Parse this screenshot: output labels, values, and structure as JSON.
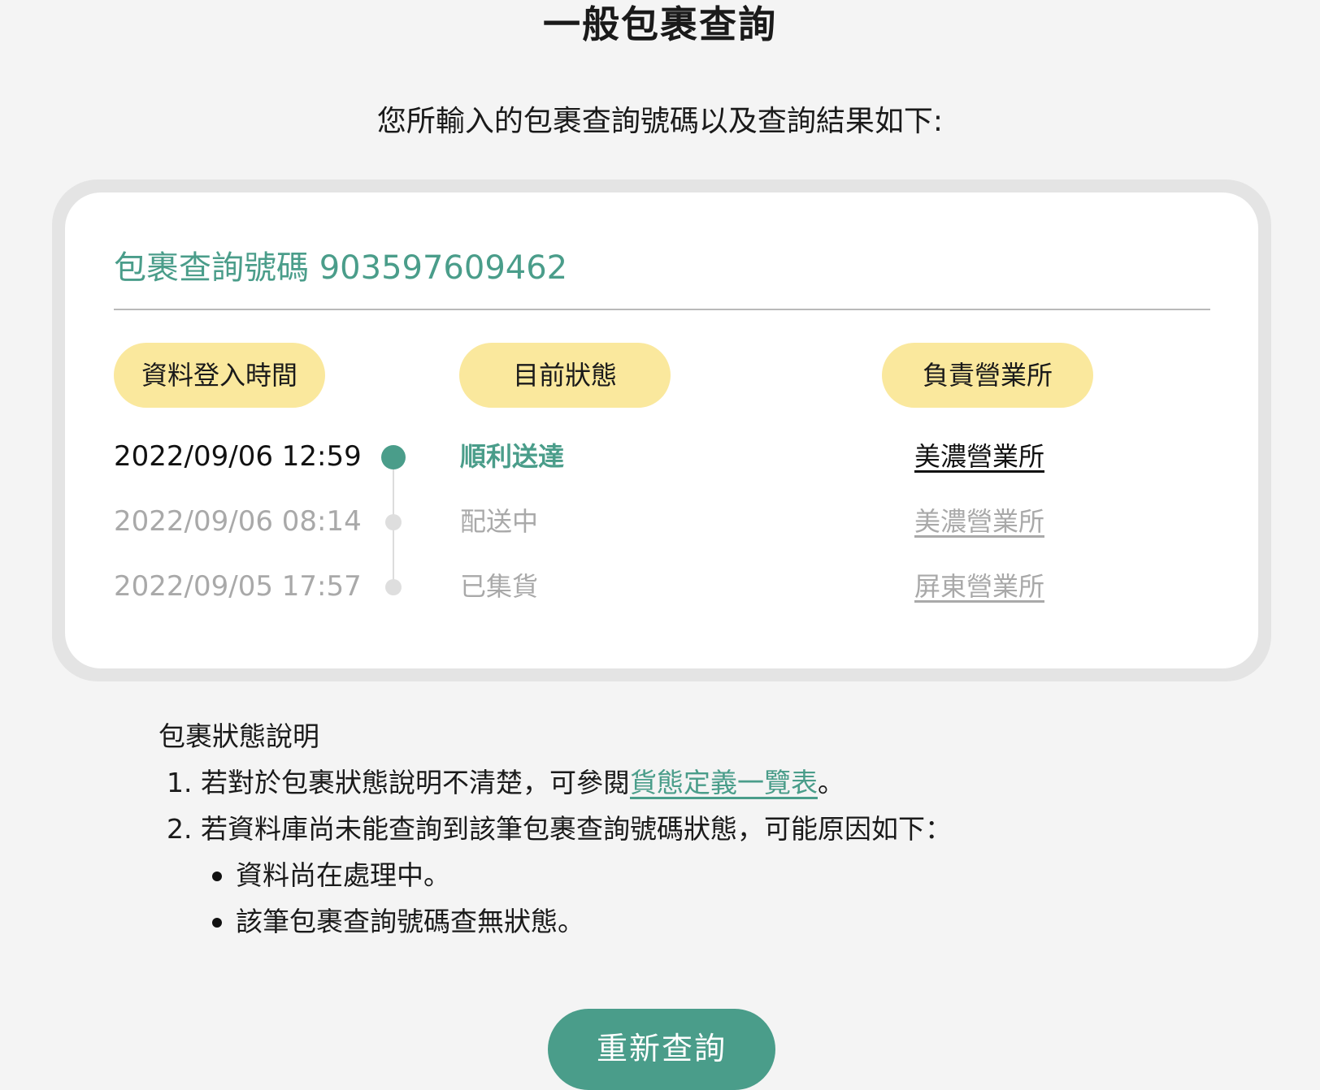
{
  "header": {
    "title": "一般包裹查詢",
    "intro": "您所輸入的包裹查詢號碼以及查詢結果如下:"
  },
  "tracking": {
    "label": "包裹查詢號碼",
    "number": "903597609462"
  },
  "columns": {
    "time": "資料登入時間",
    "status": "目前狀態",
    "office": "負責營業所"
  },
  "records": [
    {
      "time": "2022/09/06 12:59",
      "status": "順利送達",
      "office": "美濃營業所"
    },
    {
      "time": "2022/09/06 08:14",
      "status": "配送中",
      "office": "美濃營業所"
    },
    {
      "time": "2022/09/05 17:57",
      "status": "已集貨",
      "office": "屏東營業所"
    }
  ],
  "notes": {
    "heading": "包裹狀態說明",
    "item1_prefix": "1. 若對於包裹狀態說明不清楚，可參閱",
    "item1_link": "貨態定義一覽表",
    "item1_suffix": "。",
    "item2": "2. 若資料庫尚未能查詢到該筆包裹查詢號碼狀態，可能原因如下：",
    "bullets": [
      "資料尚在處理中。",
      "該筆包裹查詢號碼查無狀態。"
    ]
  },
  "actions": {
    "requery_label": "重新查詢"
  },
  "colors": {
    "accent": "#4a9d8a",
    "pill": "#fae89d",
    "muted": "#a9a9a9"
  }
}
